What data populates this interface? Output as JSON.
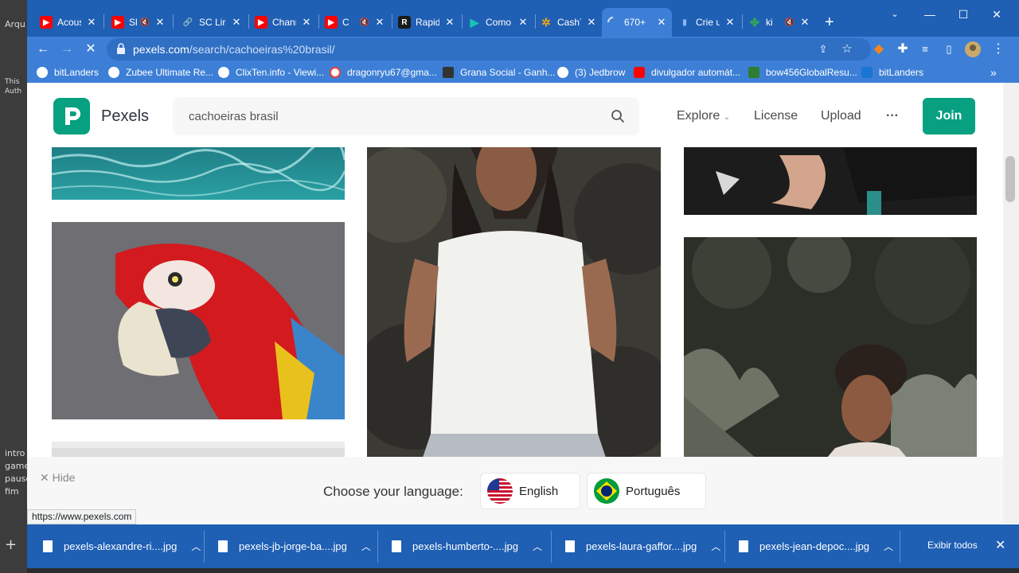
{
  "background_app": {
    "title_fragment": "Arqu",
    "text_fragment_1": "This",
    "text_fragment_2": "Auth",
    "list": [
      "intro",
      "game",
      "pause",
      "fim"
    ]
  },
  "tabs": [
    {
      "title": "Acous",
      "icon": "youtube-icon",
      "color": "#ff0000",
      "muted": false
    },
    {
      "title": "Sl",
      "icon": "youtube-icon",
      "color": "#ff0000",
      "muted": true
    },
    {
      "title": "SC Lir",
      "icon": "link-icon",
      "color": "#4a90e2",
      "muted": false
    },
    {
      "title": "Chanr",
      "icon": "youtube-icon",
      "color": "#ff0000",
      "muted": false
    },
    {
      "title": "C",
      "icon": "youtube-icon",
      "color": "#ff0000",
      "muted": true
    },
    {
      "title": "Rapid",
      "icon": "rapid-icon",
      "color": "#1a1a1a",
      "muted": false
    },
    {
      "title": "Como",
      "icon": "play-icon",
      "color": "#19c3b0",
      "muted": false
    },
    {
      "title": "CashT",
      "icon": "pinwheel-icon",
      "color": "#e8a317",
      "muted": false
    },
    {
      "title": "670+",
      "icon": "loading-icon",
      "color": "#8ab4f8",
      "muted": false
    },
    {
      "title": "Crie u",
      "icon": "microphone-icon",
      "color": "#4285f4",
      "muted": false
    },
    {
      "title": "ki",
      "icon": "leaf-icon",
      "color": "#34a853",
      "muted": true
    }
  ],
  "address_bar": {
    "host": "pexels.com",
    "path": "/search/cachoeiras%20brasil/"
  },
  "bookmarks": [
    {
      "label": "bitLanders",
      "color": "#ffffff"
    },
    {
      "label": "Zubee Ultimate Re...",
      "color": "#ffffff"
    },
    {
      "label": "ClixTen.info - Viewi...",
      "color": "#ffffff"
    },
    {
      "label": "dragonryu67@gma...",
      "color": "#ffffff"
    },
    {
      "label": "Grana Social - Ganh...",
      "color": "#333333"
    },
    {
      "label": "(3) Jedbrow",
      "color": "#ffffff"
    },
    {
      "label": "divulgador automát...",
      "color": "#ff0000"
    },
    {
      "label": "bow456GlobalResu...",
      "color": "#2e7d32"
    },
    {
      "label": "bitLanders",
      "color": "#1976d2"
    }
  ],
  "pexels": {
    "brand": "Pexels",
    "search_value": "cachoeiras brasil",
    "nav": {
      "explore": "Explore",
      "license": "License",
      "upload": "Upload",
      "more": "···",
      "join": "Join"
    },
    "accent": "#07a081"
  },
  "photos": [
    {
      "name": "ocean-water-photo",
      "subject": "turquoise ocean water"
    },
    {
      "name": "red-macaw-photo",
      "subject": "red macaw parrot"
    },
    {
      "name": "white-sky-photo",
      "subject": "pale sky"
    },
    {
      "name": "woman-white-tshirt-photo",
      "subject": "woman in white t-shirt"
    },
    {
      "name": "dark-scene-photo",
      "subject": "dark scene"
    },
    {
      "name": "woman-garden-photo",
      "subject": "woman in garden"
    }
  ],
  "language_bar": {
    "hide": "Hide",
    "label": "Choose your language:",
    "options": [
      "English",
      "Português"
    ]
  },
  "status_url": "https://www.pexels.com",
  "downloads": {
    "files": [
      "pexels-alexandre-ri....jpg",
      "pexels-jb-jorge-ba....jpg",
      "pexels-humberto-....jpg",
      "pexels-laura-gaffor....jpg",
      "pexels-jean-depoc....jpg"
    ],
    "show_all": "Exibir todos"
  }
}
